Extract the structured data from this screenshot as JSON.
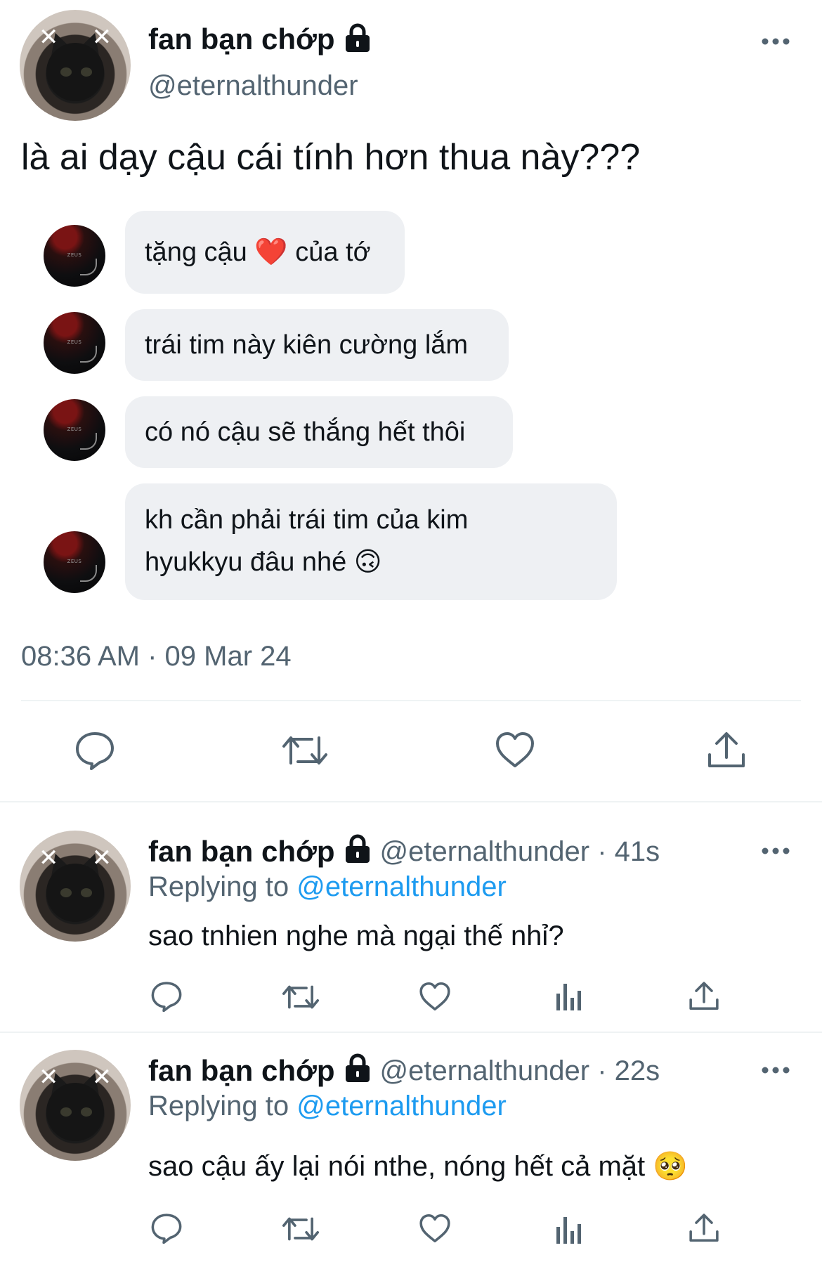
{
  "main_tweet": {
    "display_name": "fan bạn chớp",
    "handle": "@eternalthunder",
    "text": "là ai dạy cậu cái tính hơn thua này???",
    "timestamp": "08:36 AM · 09 Mar 24",
    "embedded_chat": [
      {
        "lines": [
          "tặng cậu ❤️  của tớ"
        ]
      },
      {
        "lines": [
          "trái tim này kiên cường lắm"
        ]
      },
      {
        "lines": [
          "có nó cậu sẽ thắng hết thôi"
        ]
      },
      {
        "lines": [
          "kh cần phải trái tim của kim",
          "hyukkyu đâu nhé 🙃"
        ]
      }
    ],
    "chat_avatar_label": "ZEUS",
    "actions": [
      "reply-icon",
      "retweet-icon",
      "like-icon",
      "share-icon"
    ]
  },
  "replies": [
    {
      "display_name": "fan bạn chớp",
      "handle_time": "@eternalthunder · 41s",
      "replying_label": "Replying to",
      "replying_handle": "@eternalthunder",
      "text": "sao tnhien nghe mà ngại thế nhỉ?"
    },
    {
      "display_name": "fan bạn chớp",
      "handle_time": "@eternalthunder · 22s",
      "replying_label": "Replying to",
      "replying_handle": "@eternalthunder",
      "text": "sao cậu ấy lại nói nthe, nóng hết cả mặt 🥺"
    }
  ],
  "colors": {
    "text": "#0f1419",
    "muted": "#536471",
    "link": "#1d9bf0",
    "bubble": "#eef0f3",
    "divider": "#eff3f4"
  }
}
